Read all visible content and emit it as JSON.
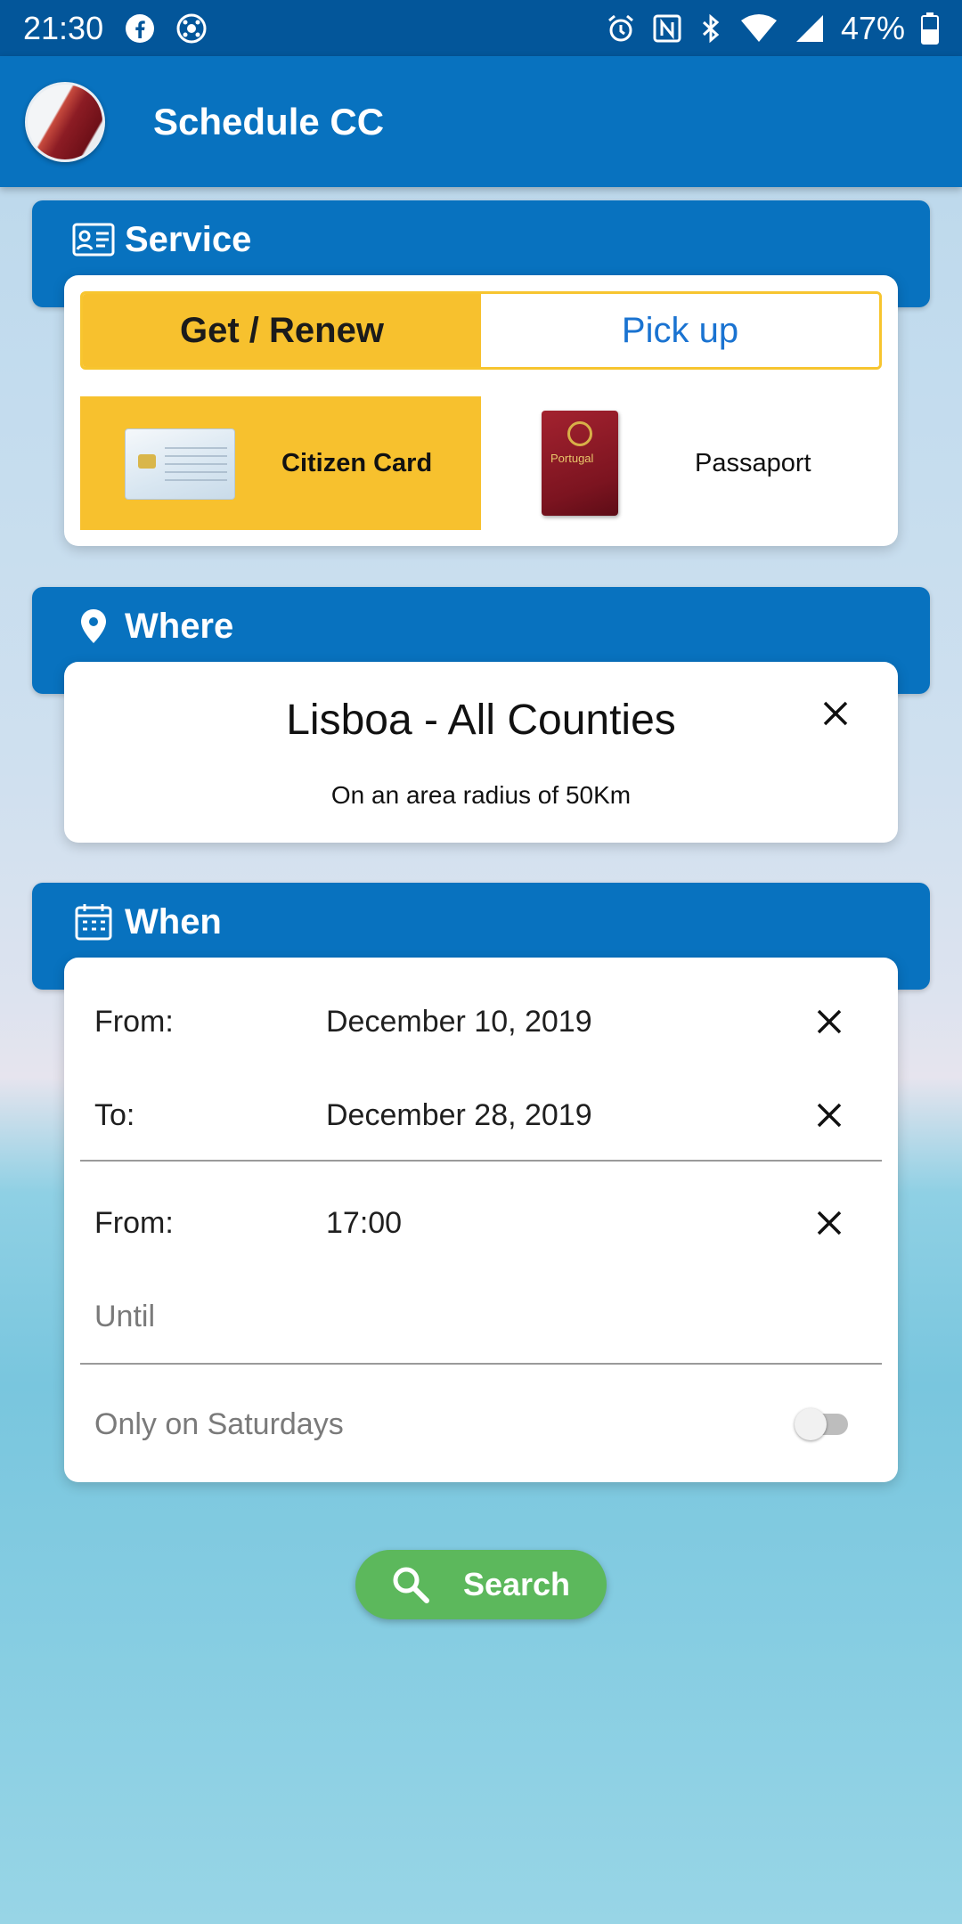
{
  "status_bar": {
    "time": "21:30",
    "battery": "47%",
    "icons": [
      "facebook-icon",
      "soccer-ball-icon",
      "alarm-icon",
      "nfc-icon",
      "bluetooth-icon",
      "wifi-icon",
      "signal-icon",
      "battery-icon"
    ]
  },
  "app_bar": {
    "title": "Schedule CC",
    "logo_icon": "passport-card-logo"
  },
  "service": {
    "header": "Service",
    "icon": "id-card-icon",
    "tabs": [
      {
        "label": "Get / Renew",
        "active": true
      },
      {
        "label": "Pick up",
        "active": false
      }
    ],
    "documents": [
      {
        "label": "Citizen Card",
        "selected": true
      },
      {
        "label": "Passaport",
        "selected": false
      }
    ],
    "passport_cover_text": "Portugal"
  },
  "where": {
    "header": "Where",
    "icon": "location-pin-icon",
    "location": "Lisboa - All Counties",
    "radius_text": "On an area radius of 50Km"
  },
  "when": {
    "header": "When",
    "icon": "calendar-icon",
    "date_from_label": "From:",
    "date_from_value": "December 10, 2019",
    "date_to_label": "To:",
    "date_to_value": "December 28, 2019",
    "time_from_label": "From:",
    "time_from_value": "17:00",
    "time_until_placeholder": "Until",
    "saturdays_label": "Only on Saturdays",
    "saturdays_on": false
  },
  "search": {
    "label": "Search",
    "icon": "search-icon"
  },
  "colors": {
    "primary": "#0872bf",
    "status_bar": "#03569a",
    "accent": "#f7c12e",
    "link": "#1a73d1",
    "search_button": "#5cb85c"
  }
}
